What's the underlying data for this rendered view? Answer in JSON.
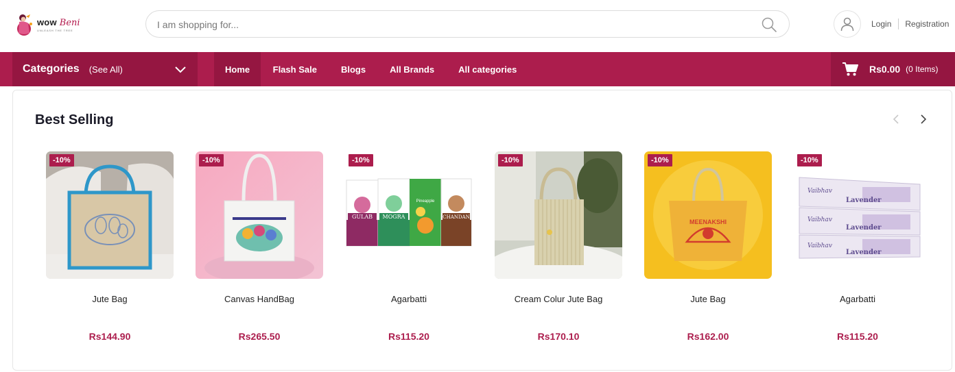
{
  "header": {
    "logo": {
      "wow": "wow",
      "beni": "Beni",
      "tagline": "UNLEASH THE TREE"
    },
    "search": {
      "placeholder": "I am shopping for..."
    },
    "auth": {
      "login": "Login",
      "register": "Registration"
    }
  },
  "nav": {
    "categories": {
      "title": "Categories",
      "see_all": "(See All)"
    },
    "menu": [
      {
        "label": "Home",
        "active": true
      },
      {
        "label": "Flash Sale"
      },
      {
        "label": "Blogs"
      },
      {
        "label": "All Brands"
      },
      {
        "label": "All categories"
      }
    ],
    "cart": {
      "amount": "Rs0.00",
      "items": "(0 Items)"
    }
  },
  "best_selling": {
    "title": "Best Selling",
    "products": [
      {
        "name": "Jute Bag",
        "price": "Rs144.90",
        "badge": "-10%"
      },
      {
        "name": "Canvas HandBag",
        "price": "Rs265.50",
        "badge": "-10%"
      },
      {
        "name": "Agarbatti",
        "price": "Rs115.20",
        "badge": "-10%"
      },
      {
        "name": "Cream Colur Jute Bag",
        "price": "Rs170.10",
        "badge": "-10%"
      },
      {
        "name": "Jute Bag",
        "price": "Rs162.00",
        "badge": "-10%"
      },
      {
        "name": "Agarbatti",
        "price": "Rs115.20",
        "badge": "-10%"
      }
    ],
    "image_text": {
      "agarbatti_1": [
        "GULAB",
        "MOGRA",
        "Pineapple",
        "CHANDAN"
      ],
      "jute_bag_2": "MEENAKSHI",
      "agarbatti_2": {
        "brand": "Vaibhav",
        "scent": "Lavender"
      }
    }
  },
  "colors": {
    "brand": "#ac1d4d",
    "brand_dark": "#951641",
    "price": "#ac1d4d"
  }
}
